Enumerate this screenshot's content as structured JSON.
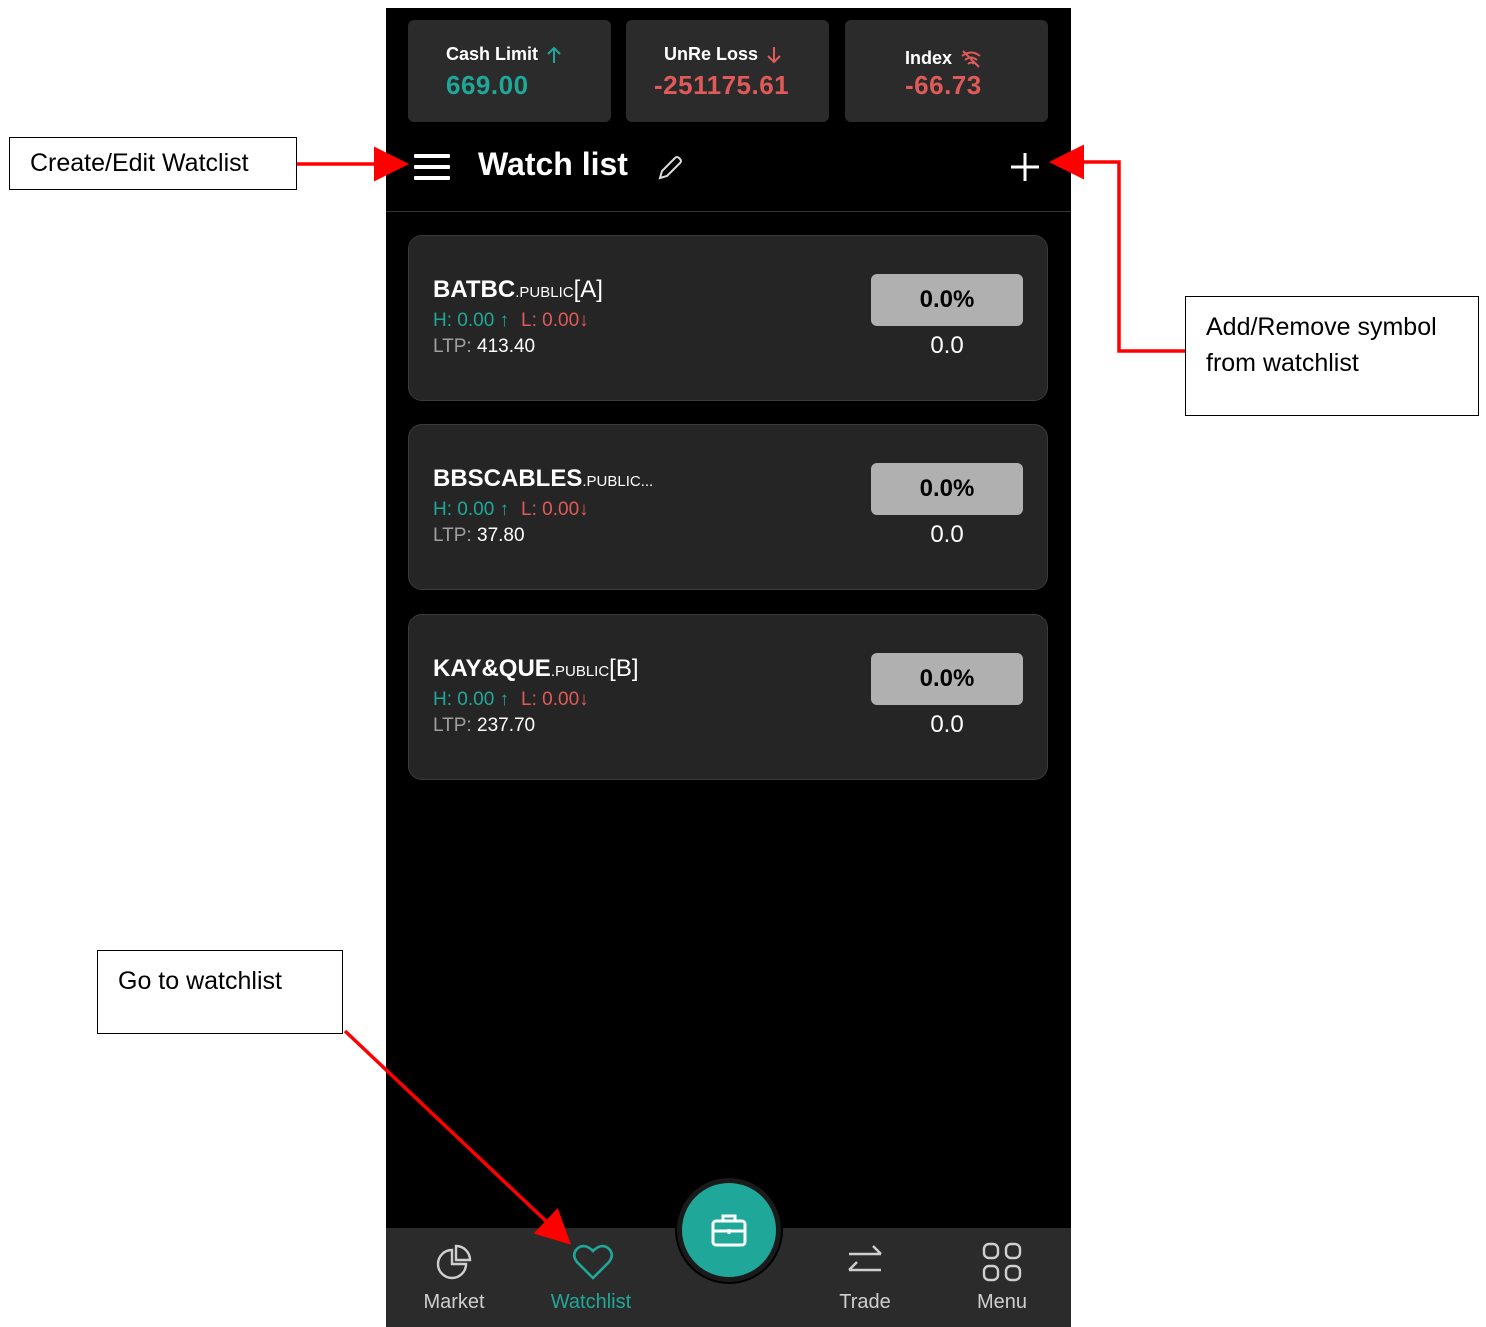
{
  "stats": [
    {
      "label": "Cash Limit",
      "value": "669.00",
      "trend": "up",
      "color": "#1fa89a",
      "icon": "arrow-up-icon"
    },
    {
      "label": "UnRe Loss",
      "value": "-251175.61",
      "trend": "down",
      "color": "#e05a5a",
      "icon": "arrow-down-icon"
    },
    {
      "label": "Index",
      "value": "-66.73",
      "trend": "offline",
      "color": "#e05a5a",
      "icon": "wifi-off-icon"
    }
  ],
  "header": {
    "title": "Watch list"
  },
  "watchlist": [
    {
      "symbol": "BATBC",
      "suffix": ".PUBLIC",
      "bracket": "[A]",
      "high": "H: 0.00",
      "low": "L: 0.00",
      "ltp_label": "LTP:",
      "ltp": "413.40",
      "pct": "0.0%",
      "change": "0.0"
    },
    {
      "symbol": "BBSCABLES",
      "suffix": ".PUBLIC...",
      "bracket": "",
      "high": "H: 0.00",
      "low": "L: 0.00",
      "ltp_label": "LTP:",
      "ltp": "37.80",
      "pct": "0.0%",
      "change": "0.0"
    },
    {
      "symbol": "KAY&QUE",
      "suffix": ".PUBLIC",
      "bracket": "[B]",
      "high": "H: 0.00",
      "low": "L: 0.00",
      "ltp_label": "LTP:",
      "ltp": "237.70",
      "pct": "0.0%",
      "change": "0.0"
    }
  ],
  "nav": [
    {
      "label": "Market",
      "icon": "pie-chart-icon",
      "active": false
    },
    {
      "label": "Watchlist",
      "icon": "heart-icon",
      "active": true
    },
    {
      "label": "Trade",
      "icon": "transfer-icon",
      "active": false
    },
    {
      "label": "Menu",
      "icon": "grid-icon",
      "active": false
    }
  ],
  "fab": {
    "icon": "briefcase-icon"
  },
  "annotations": {
    "create_edit": "Create/Edit Watclist",
    "add_remove_line1": "Add/Remove symbol",
    "add_remove_line2": "from watchlist",
    "go_to": "Go to watchlist"
  },
  "colors": {
    "accent": "#1fa89a",
    "negative": "#e05a5a",
    "annotation_arrow": "#ff0000"
  }
}
